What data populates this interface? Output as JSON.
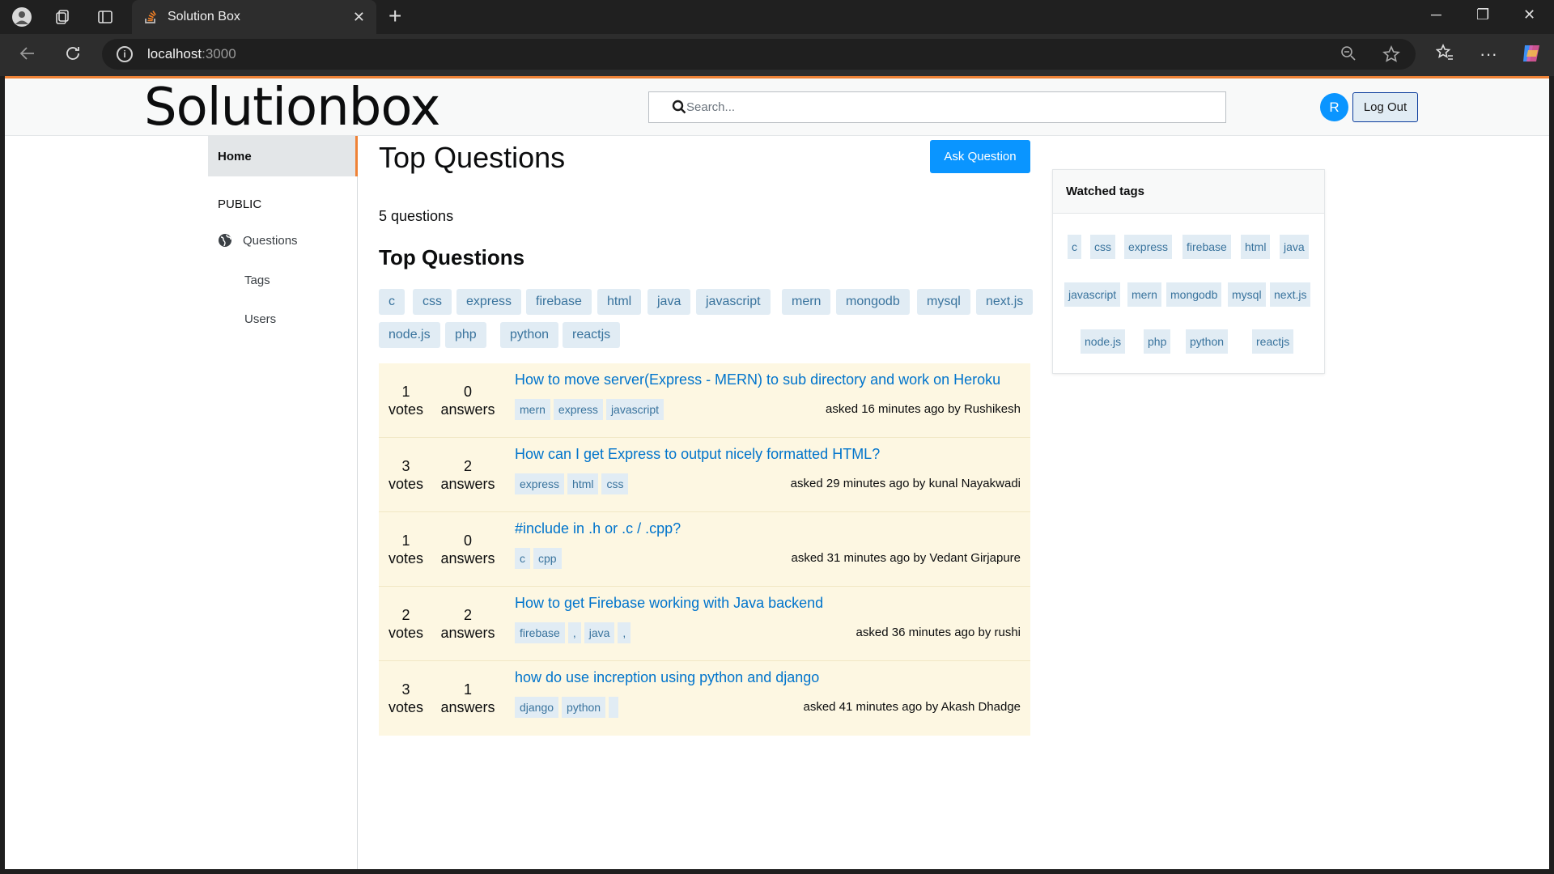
{
  "browser": {
    "tab_title": "Solution Box",
    "url_host": "localhost",
    "url_port": ":3000"
  },
  "header": {
    "logo": "Solutionbox",
    "search_placeholder": "Search...",
    "avatar_initial": "R",
    "logout_label": "Log Out"
  },
  "sidebar": {
    "home": "Home",
    "public": "PUBLIC",
    "questions": "Questions",
    "tags": "Tags",
    "users": "Users"
  },
  "main": {
    "title": "Top Questions",
    "ask_label": "Ask Question",
    "count_text": "5 questions",
    "subtitle": "Top Questions",
    "tags": [
      "c",
      "css",
      "express",
      "firebase",
      "html",
      "java",
      "javascript",
      "mern",
      "mongodb",
      "mysql",
      "next.js",
      "node.js",
      "php",
      "python",
      "reactjs"
    ],
    "questions": [
      {
        "votes": "1",
        "votes_label": "votes",
        "answers": "0",
        "answers_label": "answers",
        "title": "How to move server(Express - MERN) to sub directory and work on Heroku",
        "tags": [
          "mern",
          "express",
          "javascript"
        ],
        "meta": "asked 16 minutes ago by Rushikesh"
      },
      {
        "votes": "3",
        "votes_label": "votes",
        "answers": "2",
        "answers_label": "answers",
        "title": "How can I get Express to output nicely formatted HTML?",
        "tags": [
          "express",
          "html",
          "css"
        ],
        "meta": "asked 29 minutes ago by kunal Nayakwadi"
      },
      {
        "votes": "1",
        "votes_label": "votes",
        "answers": "0",
        "answers_label": "answers",
        "title": "#include in .h or .c / .cpp?",
        "tags": [
          "c",
          "cpp"
        ],
        "meta": "asked 31 minutes ago by Vedant Girjapure"
      },
      {
        "votes": "2",
        "votes_label": "votes",
        "answers": "2",
        "answers_label": "answers",
        "title": "How to get Firebase working with Java backend",
        "tags": [
          "firebase",
          ",",
          "java",
          ","
        ],
        "meta": "asked 36 minutes ago by rushi"
      },
      {
        "votes": "3",
        "votes_label": "votes",
        "answers": "1",
        "answers_label": "answers",
        "title": "how do use increption using python and django",
        "tags": [
          "django",
          "python",
          ""
        ],
        "meta": "asked 41 minutes ago by Akash Dhadge"
      }
    ]
  },
  "watched": {
    "title": "Watched tags",
    "tags": [
      "c",
      "css",
      "express",
      "firebase",
      "html",
      "java",
      "javascript",
      "mern",
      "mongodb",
      "mysql",
      "next.js",
      "node.js",
      "php",
      "python",
      "reactjs"
    ]
  },
  "colors": {
    "accent": "#ef8236",
    "primary": "#0a95ff",
    "tag_bg": "#e1ecf4",
    "tag_text": "#39739d",
    "question_bg": "#fdf7e2",
    "link": "#0074cc"
  }
}
